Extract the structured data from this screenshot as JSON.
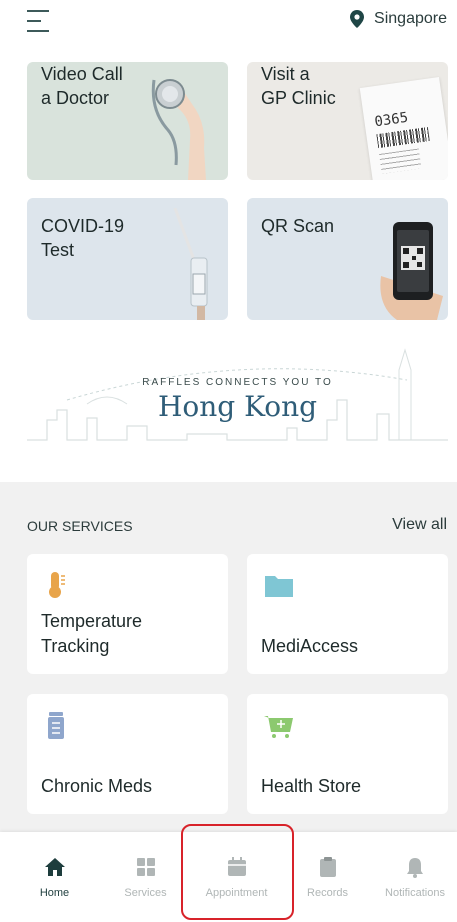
{
  "header": {
    "menu_icon": "hamburger-menu-icon",
    "location_icon": "location-pin-icon",
    "location": "Singapore"
  },
  "tiles": [
    {
      "label": "Video Call\na Doctor",
      "image": "stethoscope-image"
    },
    {
      "label": "Visit a\nGP Clinic",
      "image": "queue-ticket-image",
      "ticket_number": "0365"
    },
    {
      "label": "COVID-19\nTest",
      "image": "swab-test-image"
    },
    {
      "label": "QR Scan",
      "image": "phone-qr-image"
    }
  ],
  "banner": {
    "small_text": "RAFFLES CONNECTS YOU TO",
    "big_text": "Hong Kong"
  },
  "services": {
    "title": "OUR SERVICES",
    "view_all": "View all",
    "items": [
      {
        "label": "Temperature\nTracking",
        "icon": "thermometer-icon",
        "color": "#e8a44a"
      },
      {
        "label": "MediAccess",
        "icon": "folder-icon",
        "color": "#7fc6d4"
      },
      {
        "label": "Chronic Meds",
        "icon": "pill-bottle-icon",
        "color": "#8fa6cc"
      },
      {
        "label": "Health Store",
        "icon": "shopping-cart-icon",
        "color": "#8cc96f"
      }
    ]
  },
  "bottom_nav": {
    "items": [
      {
        "label": "Home",
        "icon": "home-icon",
        "active": true
      },
      {
        "label": "Services",
        "icon": "grid-icon",
        "active": false
      },
      {
        "label": "Appointment",
        "icon": "calendar-icon",
        "active": false
      },
      {
        "label": "Records",
        "icon": "clipboard-icon",
        "active": false
      },
      {
        "label": "Notifications",
        "icon": "bell-icon",
        "active": false
      }
    ]
  },
  "colors": {
    "accent": "#1e3d3d",
    "inactive": "#b0b6b6",
    "highlight": "#d8232a"
  }
}
